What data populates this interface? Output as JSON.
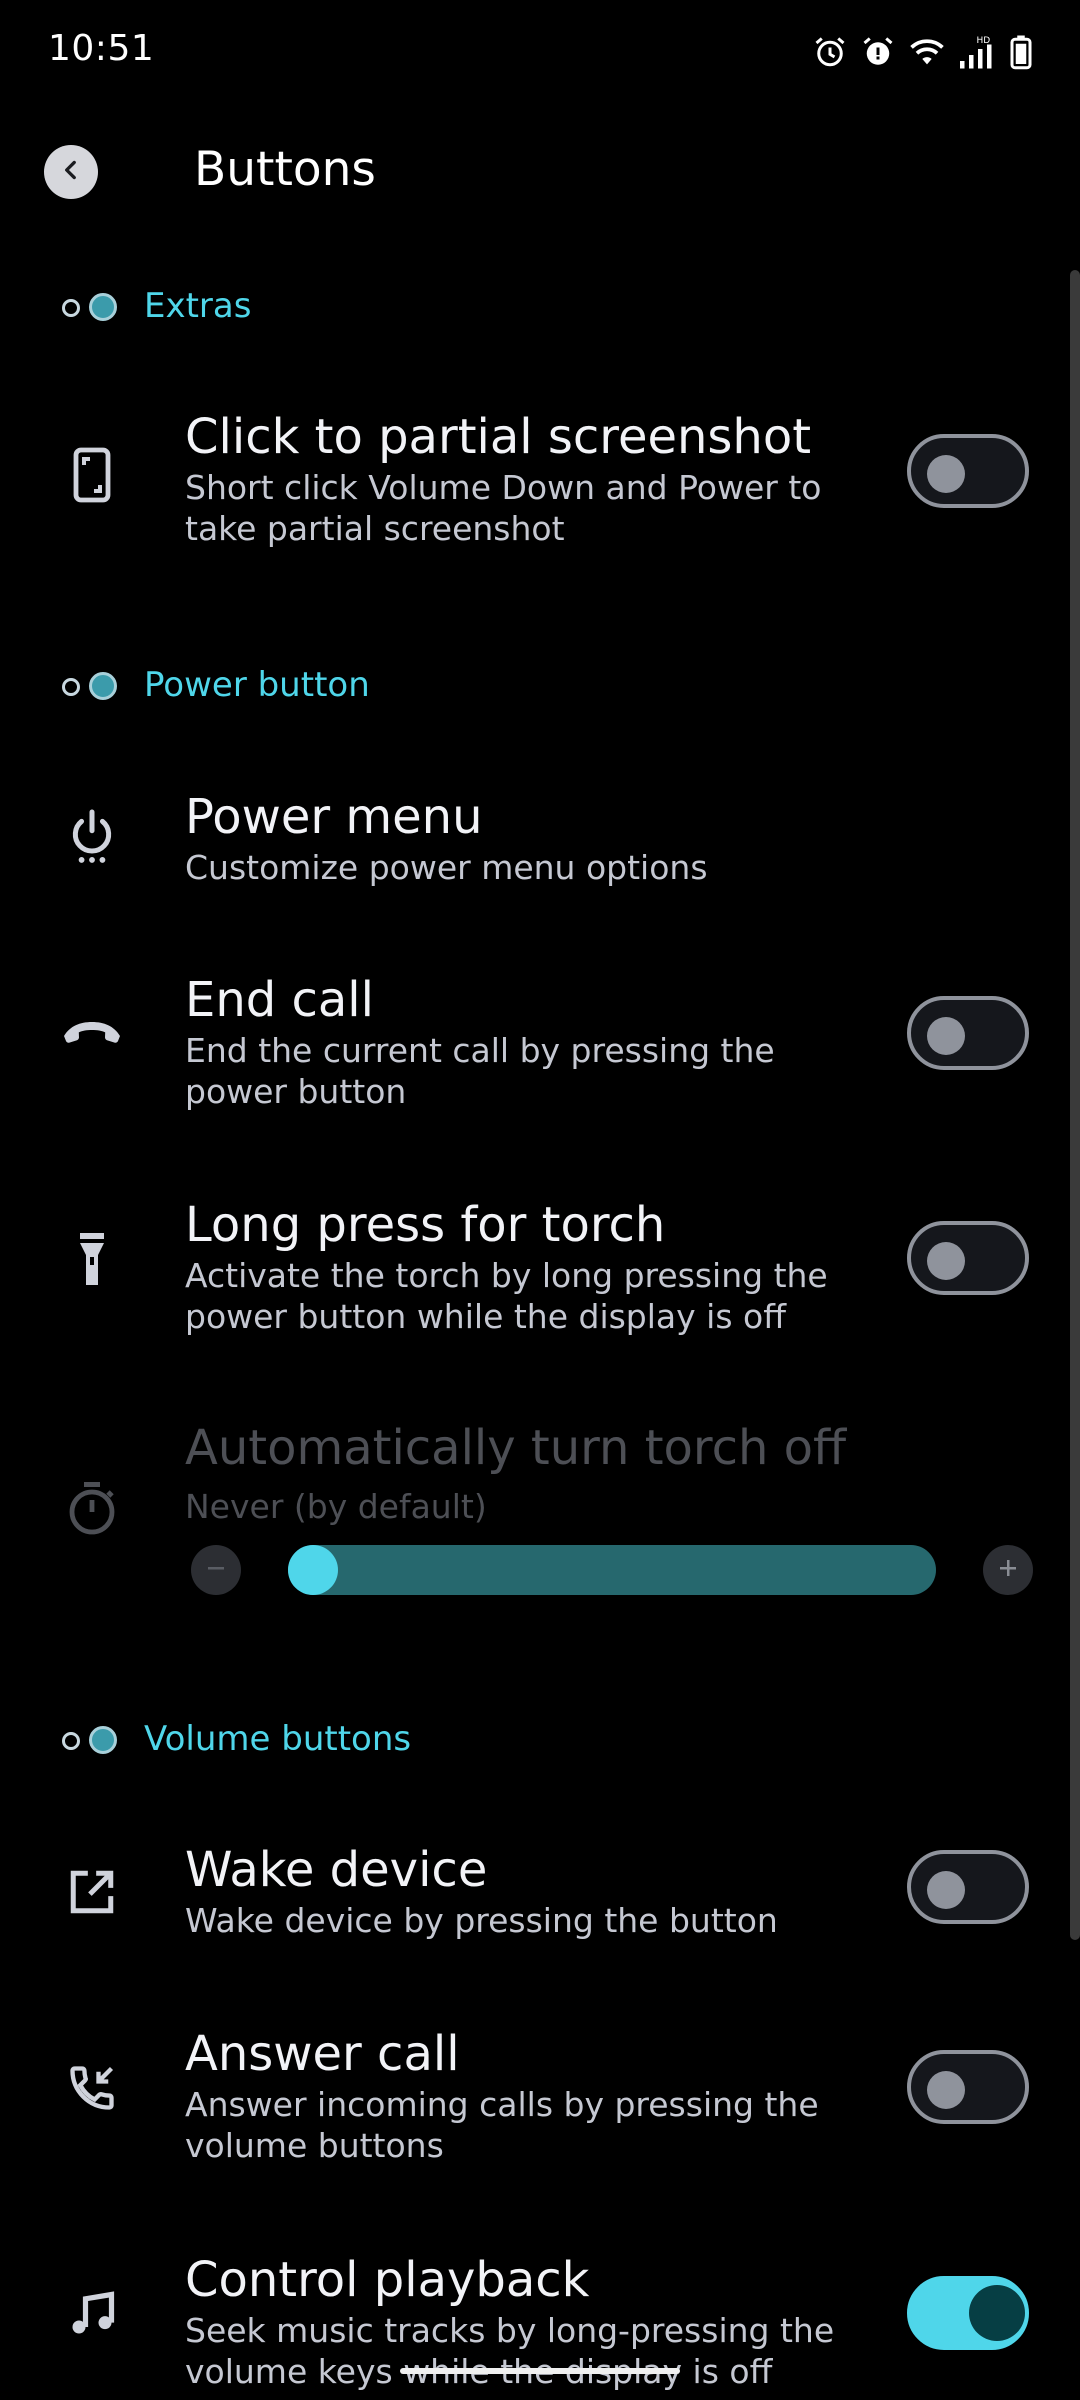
{
  "status_bar": {
    "time": "10:51",
    "icons": [
      "alarm-icon",
      "alarm-alert-icon",
      "wifi-icon",
      "signal-icon",
      "battery-icon"
    ],
    "network_label": "HD"
  },
  "header": {
    "title": "Buttons",
    "back_icon": "chevron-left-icon"
  },
  "sections": {
    "extras": {
      "label": "Extras",
      "items": {
        "partial_screenshot": {
          "icon": "phone-screenshot-icon",
          "title": "Click to partial screenshot",
          "summary": "Short click Volume Down and Power to take partial screenshot",
          "enabled": false
        }
      }
    },
    "power_button": {
      "label": "Power button",
      "items": {
        "power_menu": {
          "icon": "power-menu-icon",
          "title": "Power menu",
          "summary": "Customize power menu options"
        },
        "end_call": {
          "icon": "call-end-icon",
          "title": "End call",
          "summary": "End the current call by pressing the power button",
          "enabled": false
        },
        "long_press_torch": {
          "icon": "flashlight-icon",
          "title": "Long press for torch",
          "summary": "Activate the torch by long pressing the power button while the display is off",
          "enabled": false
        },
        "auto_torch_off": {
          "icon": "timer-icon",
          "title": "Automatically turn torch off",
          "summary": "Never (by default)",
          "disabled": true,
          "slider_level": 0.0
        }
      }
    },
    "volume_buttons": {
      "label": "Volume buttons",
      "items": {
        "wake_device": {
          "icon": "open-in-new-icon",
          "title": "Wake device",
          "summary": "Wake device by pressing the button",
          "enabled": false
        },
        "answer_call": {
          "icon": "call-received-icon",
          "title": "Answer call",
          "summary": "Answer incoming calls by pressing the volume buttons",
          "enabled": false
        },
        "control_playback": {
          "icon": "music-note-icon",
          "title": "Control playback",
          "summary": "Seek music tracks by long-pressing the volume keys while the display is off",
          "enabled": true
        }
      }
    }
  },
  "colors": {
    "background": "#000000",
    "accent": "#4fd6ea",
    "slider_track": "#26686e",
    "switch_off_border": "#8f939c",
    "disabled_text": "#4d4f55"
  }
}
